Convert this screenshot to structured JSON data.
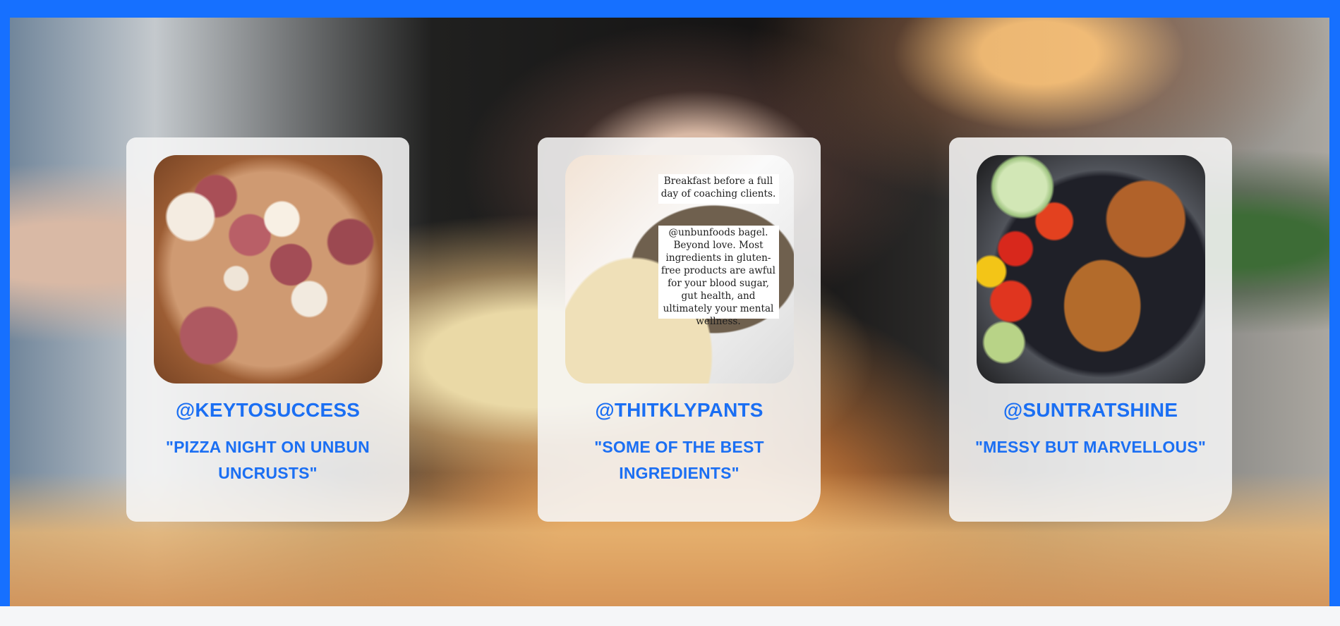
{
  "section": {
    "background_color": "#1670ff",
    "accent_text_color": "#1b6ff3"
  },
  "testimonials": [
    {
      "handle": "@KEYTOSUCCESS",
      "quote": "\"PIZZA NIGHT ON UNBUN UNCRUSTS\"",
      "photo": "pizza-photo",
      "photo_text": []
    },
    {
      "handle": "@THITKLYPANTS",
      "quote": "\"SOME OF THE BEST INGREDIENTS\"",
      "photo": "bagel-photo",
      "photo_text": [
        "Breakfast before a full day of coaching clients.",
        "@unbunfoods bagel. Beyond love. Most ingredients in gluten-free products are awful for your blood sugar, gut health, and ultimately your mental wellness."
      ]
    },
    {
      "handle": "@SUNTRATSHINE",
      "quote": "\"MESSY BUT MARVELLOUS\"",
      "photo": "salad-photo",
      "photo_text": []
    }
  ]
}
